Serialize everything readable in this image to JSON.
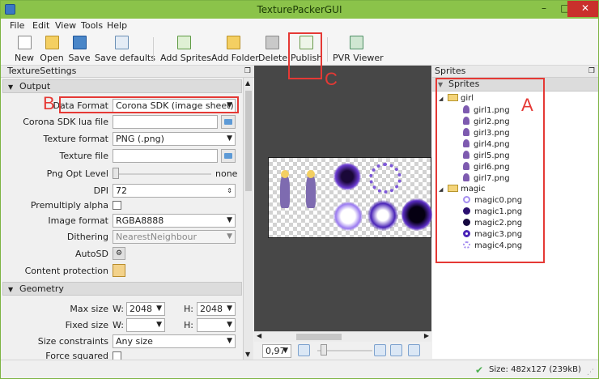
{
  "window": {
    "title": "TexturePackerGUI",
    "minimize": "–",
    "maximize": "□",
    "close": "✕"
  },
  "menu": [
    "File",
    "Edit",
    "View",
    "Tools",
    "Help"
  ],
  "toolbar": [
    {
      "label": "New",
      "icon": "new-document-icon"
    },
    {
      "label": "Open",
      "icon": "open-folder-icon"
    },
    {
      "label": "Save",
      "icon": "save-disk-icon"
    },
    {
      "label": "Save defaults",
      "icon": "save-defaults-icon"
    },
    {
      "label": "Add Sprites",
      "icon": "add-sprites-icon"
    },
    {
      "label": "Add Folder",
      "icon": "add-folder-icon"
    },
    {
      "label": "Delete",
      "icon": "trash-icon"
    },
    {
      "label": "Publish",
      "icon": "publish-icon"
    },
    {
      "label": "PVR Viewer",
      "icon": "pvr-viewer-icon"
    }
  ],
  "annotations": {
    "a": "A",
    "b": "B",
    "c": "C"
  },
  "left_panel": {
    "title": "TextureSettings",
    "output_section": "Output",
    "geometry_section": "Geometry",
    "fields": {
      "data_format": {
        "label": "Data Format",
        "value": "Corona SDK (image sheet)"
      },
      "corona_lua": {
        "label": "Corona SDK lua file",
        "value": ""
      },
      "texture_format": {
        "label": "Texture format",
        "value": "PNG (.png)"
      },
      "texture_file": {
        "label": "Texture file",
        "value": ""
      },
      "png_opt": {
        "label": "Png Opt Level",
        "value": "none"
      },
      "dpi": {
        "label": "DPI",
        "value": "72"
      },
      "premultiply": {
        "label": "Premultiply alpha",
        "checked": false
      },
      "image_format": {
        "label": "Image format",
        "value": "RGBA8888"
      },
      "dithering": {
        "label": "Dithering",
        "value": "NearestNeighbour"
      },
      "autosd": {
        "label": "AutoSD"
      },
      "content_protection": {
        "label": "Content protection"
      },
      "max_size": {
        "label": "Max size",
        "w_label": "W:",
        "w": "2048",
        "h_label": "H:",
        "h": "2048"
      },
      "fixed_size": {
        "label": "Fixed size",
        "w_label": "W:",
        "w": "",
        "h_label": "H:",
        "h": ""
      },
      "size_constraints": {
        "label": "Size constraints",
        "value": "Any size"
      },
      "force_squared": {
        "label": "Force squared",
        "checked": false
      }
    }
  },
  "canvas": {
    "zoom": "0,97"
  },
  "right_panel": {
    "title": "Sprites",
    "header": "Sprites",
    "groups": [
      {
        "name": "girl",
        "items": [
          "girl1.png",
          "girl2.png",
          "girl3.png",
          "girl4.png",
          "girl5.png",
          "girl6.png",
          "girl7.png"
        ]
      },
      {
        "name": "magic",
        "items": [
          "magic0.png",
          "magic1.png",
          "magic2.png",
          "magic3.png",
          "magic4.png"
        ]
      }
    ]
  },
  "status": {
    "text": "Size: 482x127 (239kB)"
  }
}
